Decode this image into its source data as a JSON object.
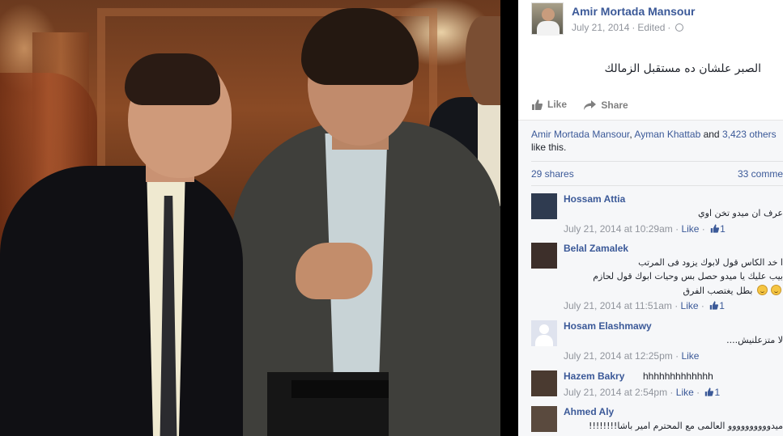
{
  "post": {
    "author": "Amir Mortada Mansour",
    "date": "July 21, 2014",
    "edited": "Edited",
    "dot": "·",
    "status": "الصبر علشان ده مستقبل الزمالك"
  },
  "actions": {
    "like": "Like",
    "share": "Share"
  },
  "feedback": {
    "liker1": "Amir Mortada Mansour",
    "sep1": ", ",
    "liker2": "Ayman Khattab",
    "and": " and ",
    "others": "3,423 others",
    "suffix": "like this.",
    "shares": "29 shares",
    "comments_count": "33 comme"
  },
  "comments": [
    {
      "name": "Hossam Attia",
      "lines": [
        "عرف ان ميدو تخن اوي"
      ],
      "time": "July 21, 2014 at 10:29am",
      "like": "Like",
      "likes": "1"
    },
    {
      "name": "Belal Zamalek",
      "lines": [
        "ا خد الكاس قول لابوك يزود فى المرتب",
        "بيب عليك يا ميدو حصل بس وحيات ابوك قول لحازم",
        "بطل يغتصب الفرق"
      ],
      "time": "July 21, 2014 at 11:51am",
      "like": "Like",
      "likes": "1"
    },
    {
      "name": "Hosam Elashmawy",
      "lines": [
        "لا متزعلنيش...."
      ],
      "time": "July 21, 2014 at 12:25pm",
      "like": "Like",
      "likes": ""
    },
    {
      "name": "Hazem Bakry",
      "inline": "hhhhhhhhhhhhh",
      "time": "July 21, 2014 at 2:54pm",
      "like": "Like",
      "likes": "1"
    },
    {
      "name": "Ahmed Aly",
      "lines": [
        "ميدوووووووووو العالمى مع المحترم امير باشا!!!!!!!!"
      ]
    }
  ],
  "meta_sep": " · ",
  "icons": {
    "globe": "globe-icon",
    "like": "thumbs-up-icon",
    "share": "share-arrow-icon",
    "smiley": "smiley-emoji-icon"
  },
  "colors": {
    "link": "#3b5998",
    "muted": "#90949c",
    "feedback_bg": "#f6f7f9"
  }
}
